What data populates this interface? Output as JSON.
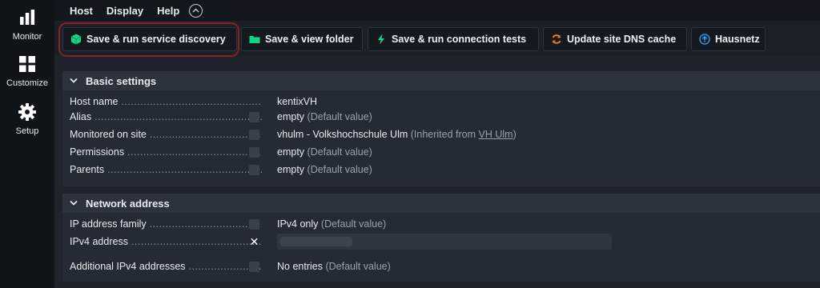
{
  "sidebar": {
    "items": [
      {
        "label": "Monitor",
        "icon": "bar-chart-icon"
      },
      {
        "label": "Customize",
        "icon": "grid-icon"
      },
      {
        "label": "Setup",
        "icon": "gear-icon"
      }
    ]
  },
  "menubar": {
    "items": [
      "Host",
      "Display",
      "Help"
    ]
  },
  "actions": [
    {
      "label": "Save & run service discovery",
      "icon": "cube-icon",
      "color": "#13d389"
    },
    {
      "label": "Save & view folder",
      "icon": "folder-icon",
      "color": "#13d389"
    },
    {
      "label": "Save & run connection tests",
      "icon": "bolt-icon",
      "color": "#13d389"
    },
    {
      "label": "Update site DNS cache",
      "icon": "refresh-icon",
      "color": "#f07a1f"
    },
    {
      "label": "Hausnetz",
      "icon": "arrow-up-circle-icon",
      "color": "#2f8fe0"
    }
  ],
  "basic_settings": {
    "title": "Basic settings",
    "rows": [
      {
        "label": "Host name",
        "value": "kentixVH",
        "note": ""
      },
      {
        "label": "Alias",
        "value": "empty",
        "note": "(Default value)"
      },
      {
        "label": "Monitored on site",
        "value": "vhulm - Volkshochschule Ulm",
        "note": "(Inherited from",
        "link": "VH Ulm",
        "note_end": ")"
      },
      {
        "label": "Permissions",
        "value": "empty",
        "note": "(Default value)"
      },
      {
        "label": "Parents",
        "value": "empty",
        "note": "(Default value)"
      }
    ]
  },
  "network_address": {
    "title": "Network address",
    "rows": [
      {
        "label": "IP address family",
        "value": "IPv4 only",
        "note": "(Default value)"
      },
      {
        "label": "IPv4 address",
        "value": "",
        "note": ""
      },
      {
        "label": "Additional IPv4 addresses",
        "value": "No entries",
        "note": "(Default value)"
      }
    ]
  }
}
